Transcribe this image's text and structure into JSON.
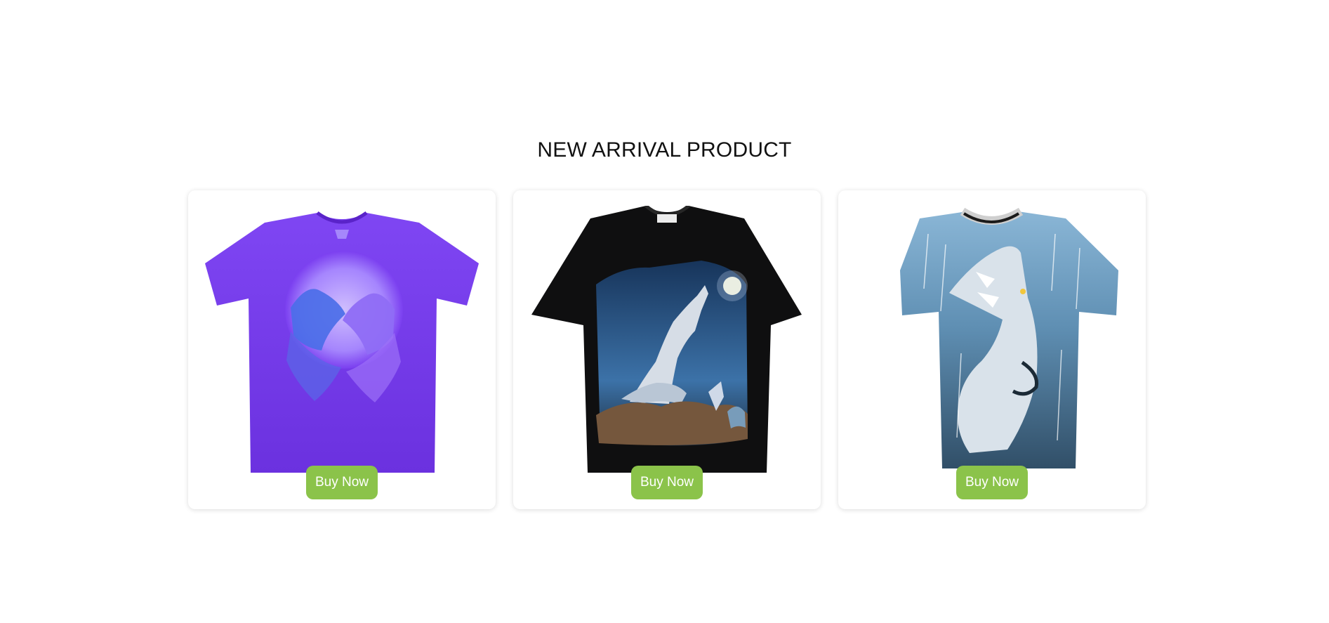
{
  "section": {
    "title": "NEW ARRIVAL PRODUCT"
  },
  "products": [
    {
      "image_icon": "purple-wolf-moon-tshirt",
      "shirt_color": "#7b3ff0",
      "button_label": "Buy Now"
    },
    {
      "image_icon": "black-howling-wolf-tshirt",
      "shirt_color": "#111111",
      "button_label": "Buy Now"
    },
    {
      "image_icon": "blue-rain-wolf-tshirt",
      "shirt_color": "#5f8fb3",
      "button_label": "Buy Now"
    }
  ],
  "colors": {
    "button": "#8bc34a",
    "title": "#111111"
  }
}
